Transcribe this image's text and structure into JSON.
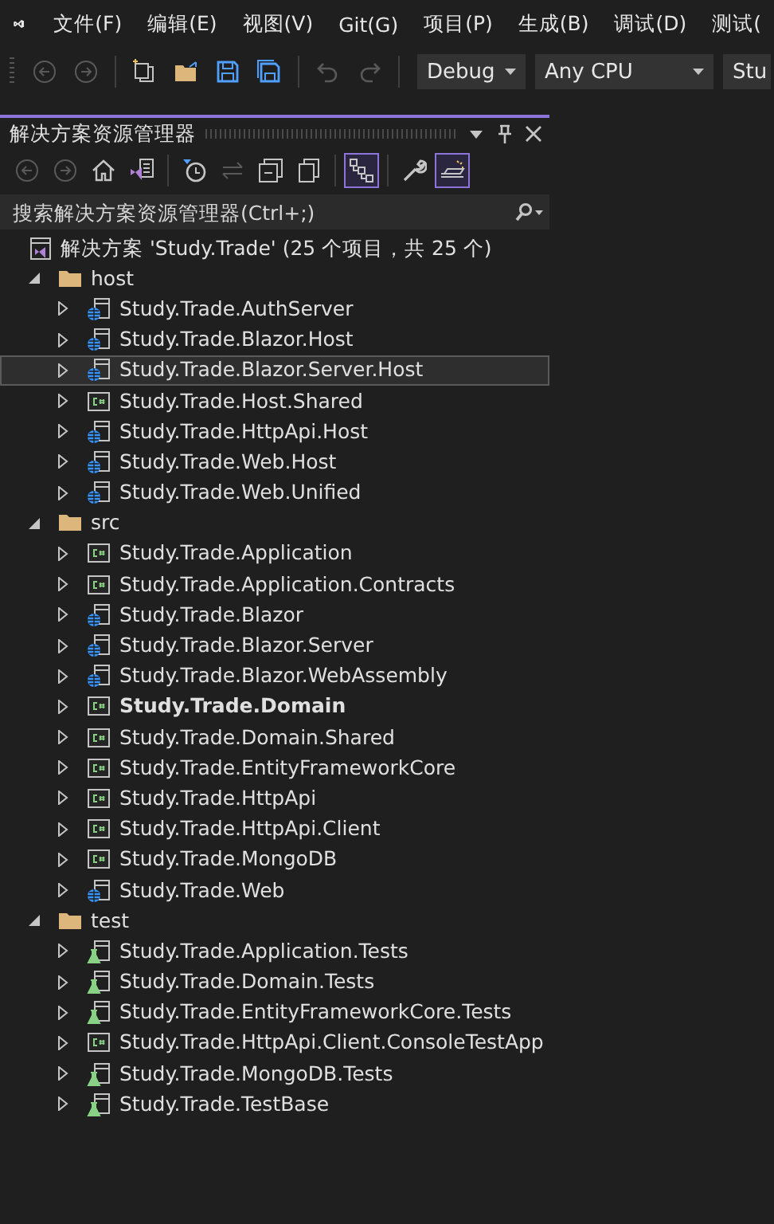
{
  "menu": [
    {
      "label": "文件(F)"
    },
    {
      "label": "编辑(E)"
    },
    {
      "label": "视图(V)"
    },
    {
      "label": "Git(G)"
    },
    {
      "label": "项目(P)"
    },
    {
      "label": "生成(B)"
    },
    {
      "label": "调试(D)"
    },
    {
      "label": "测试("
    }
  ],
  "main_toolbar": [
    {
      "kind": "back",
      "disabled": true
    },
    {
      "kind": "forward",
      "disabled": true
    },
    {
      "kind": "sep"
    },
    {
      "kind": "new-item",
      "disabled": false
    },
    {
      "kind": "open",
      "disabled": false
    },
    {
      "kind": "save",
      "disabled": false
    },
    {
      "kind": "save-all",
      "disabled": false
    },
    {
      "kind": "sep"
    },
    {
      "kind": "undo",
      "disabled": true
    },
    {
      "kind": "redo",
      "disabled": true
    },
    {
      "kind": "sep"
    }
  ],
  "dropdowns": [
    {
      "value": "Debug"
    },
    {
      "value": "Any CPU"
    },
    {
      "value": "Stu"
    }
  ],
  "panel": {
    "title": "解决方案资源管理器",
    "toolbar": [
      {
        "kind": "back",
        "disabled": true,
        "on": false
      },
      {
        "kind": "forward",
        "disabled": true,
        "on": false
      },
      {
        "kind": "home",
        "disabled": false,
        "on": false
      },
      {
        "kind": "switch-views",
        "disabled": false,
        "on": false
      },
      {
        "kind": "sep"
      },
      {
        "kind": "pending",
        "disabled": false,
        "on": false
      },
      {
        "kind": "sync",
        "disabled": true,
        "on": false
      },
      {
        "kind": "collapse",
        "disabled": false,
        "on": false
      },
      {
        "kind": "show-all",
        "disabled": false,
        "on": false
      },
      {
        "kind": "sep"
      },
      {
        "kind": "view",
        "disabled": false,
        "on": true
      },
      {
        "kind": "sep"
      },
      {
        "kind": "properties",
        "disabled": false,
        "on": false
      },
      {
        "kind": "preview",
        "disabled": false,
        "on": true
      }
    ],
    "search": {
      "placeholder": "搜索解决方案资源管理器(Ctrl+;)"
    },
    "tree": {
      "label": "解决方案 'Study.Trade' (25 个项目，共 25 个)",
      "kind": "solution",
      "children": [
        {
          "label": "host",
          "kind": "folder",
          "expanded": true,
          "children": [
            {
              "label": "Study.Trade.AuthServer",
              "kind": "web",
              "selected": false,
              "startup": false
            },
            {
              "label": "Study.Trade.Blazor.Host",
              "kind": "web",
              "selected": false,
              "startup": false
            },
            {
              "label": "Study.Trade.Blazor.Server.Host",
              "kind": "web",
              "selected": true,
              "startup": false
            },
            {
              "label": "Study.Trade.Host.Shared",
              "kind": "csharp",
              "selected": false,
              "startup": false
            },
            {
              "label": "Study.Trade.HttpApi.Host",
              "kind": "web",
              "selected": false,
              "startup": false
            },
            {
              "label": "Study.Trade.Web.Host",
              "kind": "web",
              "selected": false,
              "startup": false
            },
            {
              "label": "Study.Trade.Web.Unified",
              "kind": "web",
              "selected": false,
              "startup": false
            }
          ]
        },
        {
          "label": "src",
          "kind": "folder",
          "expanded": true,
          "children": [
            {
              "label": "Study.Trade.Application",
              "kind": "csharp",
              "selected": false,
              "startup": false
            },
            {
              "label": "Study.Trade.Application.Contracts",
              "kind": "csharp",
              "selected": false,
              "startup": false
            },
            {
              "label": "Study.Trade.Blazor",
              "kind": "web",
              "selected": false,
              "startup": false
            },
            {
              "label": "Study.Trade.Blazor.Server",
              "kind": "web",
              "selected": false,
              "startup": false
            },
            {
              "label": "Study.Trade.Blazor.WebAssembly",
              "kind": "web",
              "selected": false,
              "startup": false
            },
            {
              "label": "Study.Trade.Domain",
              "kind": "csharp",
              "selected": false,
              "startup": true
            },
            {
              "label": "Study.Trade.Domain.Shared",
              "kind": "csharp",
              "selected": false,
              "startup": false
            },
            {
              "label": "Study.Trade.EntityFrameworkCore",
              "kind": "csharp",
              "selected": false,
              "startup": false
            },
            {
              "label": "Study.Trade.HttpApi",
              "kind": "csharp",
              "selected": false,
              "startup": false
            },
            {
              "label": "Study.Trade.HttpApi.Client",
              "kind": "csharp",
              "selected": false,
              "startup": false
            },
            {
              "label": "Study.Trade.MongoDB",
              "kind": "csharp",
              "selected": false,
              "startup": false
            },
            {
              "label": "Study.Trade.Web",
              "kind": "web",
              "selected": false,
              "startup": false
            }
          ]
        },
        {
          "label": "test",
          "kind": "folder",
          "expanded": true,
          "children": [
            {
              "label": "Study.Trade.Application.Tests",
              "kind": "test",
              "selected": false,
              "startup": false
            },
            {
              "label": "Study.Trade.Domain.Tests",
              "kind": "test",
              "selected": false,
              "startup": false
            },
            {
              "label": "Study.Trade.EntityFrameworkCore.Tests",
              "kind": "test",
              "selected": false,
              "startup": false
            },
            {
              "label": "Study.Trade.HttpApi.Client.ConsoleTestApp",
              "kind": "csharp",
              "selected": false,
              "startup": false
            },
            {
              "label": "Study.Trade.MongoDB.Tests",
              "kind": "test",
              "selected": false,
              "startup": false
            },
            {
              "label": "Study.Trade.TestBase",
              "kind": "test",
              "selected": false,
              "startup": false
            }
          ]
        }
      ]
    }
  }
}
